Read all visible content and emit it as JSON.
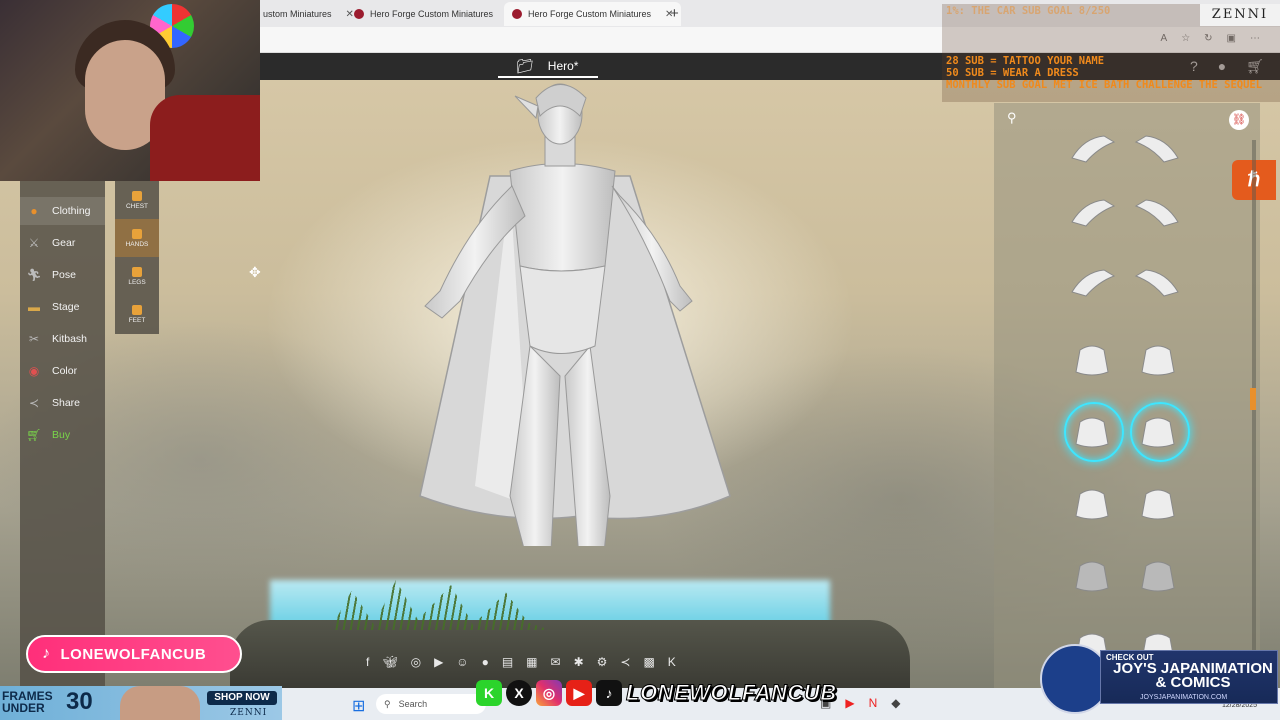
{
  "browser": {
    "tabs": [
      {
        "label": "ustom Miniatures",
        "active": false
      },
      {
        "label": "Hero Forge Custom Miniatures",
        "active": false
      },
      {
        "label": "Hero Forge Custom Miniatures",
        "active": true
      }
    ],
    "new_tab": "+"
  },
  "app": {
    "project_name": "Hero*",
    "left_nav": [
      {
        "label": "Clothing",
        "icon": "shirt-icon",
        "active": true
      },
      {
        "label": "Gear",
        "icon": "sword-icon"
      },
      {
        "label": "Pose",
        "icon": "running-figure-icon"
      },
      {
        "label": "Stage",
        "icon": "pedestal-icon"
      },
      {
        "label": "Kitbash",
        "icon": "kitbash-icon"
      },
      {
        "label": "Color",
        "icon": "palette-icon"
      },
      {
        "label": "Share",
        "icon": "share-icon"
      },
      {
        "label": "Buy",
        "icon": "cart-icon"
      }
    ],
    "sub_nav": [
      {
        "label": "CHEST",
        "active": false
      },
      {
        "label": "HANDS",
        "active": true
      },
      {
        "label": "LEGS",
        "active": false
      },
      {
        "label": "FEET",
        "active": false
      }
    ],
    "part_selected_row": 4,
    "hf_badge": "ℏ"
  },
  "overlay": {
    "goals": [
      "1%: THE CAR SUB GOAL 8/250",
      "28 SUB = TATTOO YOUR NAME",
      "50 SUB = WEAR A DRESS",
      "MONTHLY SUB GOAL MET ICE BATH CHALLENGE THE SEQUEL"
    ],
    "zenni_top": "ZENNI",
    "tiktok_handle": "LONEWOLFANCUB",
    "social_handle": "LONEWOLFANCUB",
    "ad": {
      "frames": "FRAMES\nUNDER",
      "price": "30",
      "shop": "SHOP NOW",
      "brand": "ZENNI"
    },
    "joys": {
      "check": "CHECK OUT",
      "title": "JOY'S JAPANIMATION & COMICS",
      "url": "JOYSJAPANIMATION.COM"
    }
  },
  "taskbar": {
    "search_placeholder": "Search",
    "date": "12/28/2025"
  }
}
